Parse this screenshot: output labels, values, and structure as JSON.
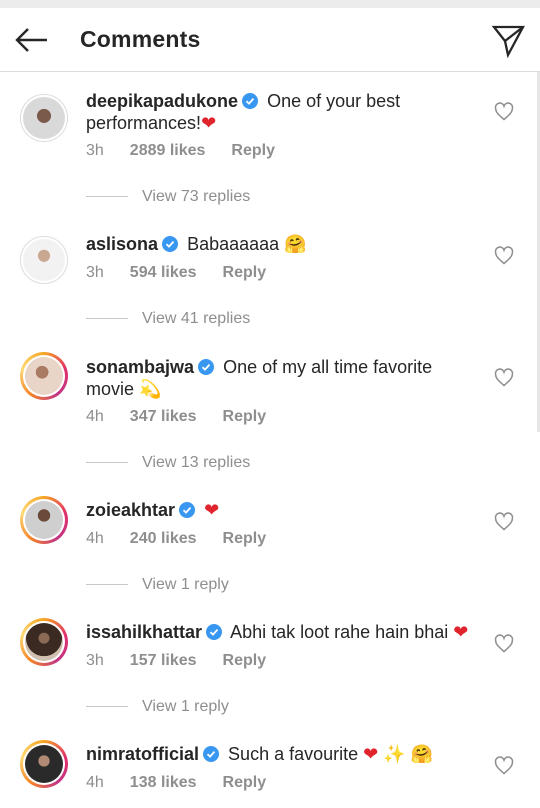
{
  "header": {
    "title": "Comments"
  },
  "icons": {
    "back": "arrow-left-icon",
    "direct": "paper-plane-icon",
    "like": "heart-outline-icon",
    "verified": "verified-badge-icon"
  },
  "colors": {
    "verified": "#3897f0",
    "heart": "#e0242d",
    "meta": "#8e8e8e"
  },
  "comments": [
    {
      "username": "deepikapadukone",
      "text": "One of your best performances!",
      "emoji": "❤",
      "time": "3h",
      "likes": "2889 likes",
      "reply": "Reply",
      "view_replies": "View 73 replies"
    },
    {
      "username": "aslisona",
      "text": "Babaaaaaa",
      "emoji": "🤗",
      "time": "3h",
      "likes": "594 likes",
      "reply": "Reply",
      "view_replies": "View 41 replies"
    },
    {
      "username": "sonambajwa",
      "text": "One of my all time favorite movie",
      "emoji": "💫",
      "time": "4h",
      "likes": "347 likes",
      "reply": "Reply",
      "view_replies": "View 13 replies"
    },
    {
      "username": "zoieakhtar",
      "text": "",
      "emoji": "❤",
      "time": "4h",
      "likes": "240 likes",
      "reply": "Reply",
      "view_replies": "View 1 reply"
    },
    {
      "username": "issahilkhattar",
      "text": "Abhi tak loot rahe hain bhai",
      "emoji": "❤",
      "time": "3h",
      "likes": "157 likes",
      "reply": "Reply",
      "view_replies": "View 1 reply"
    },
    {
      "username": "nimratofficial",
      "text": "Such a favourite",
      "emoji": "❤ ✨ 🤗",
      "time": "4h",
      "likes": "138 likes",
      "reply": "Reply",
      "view_replies": ""
    }
  ]
}
